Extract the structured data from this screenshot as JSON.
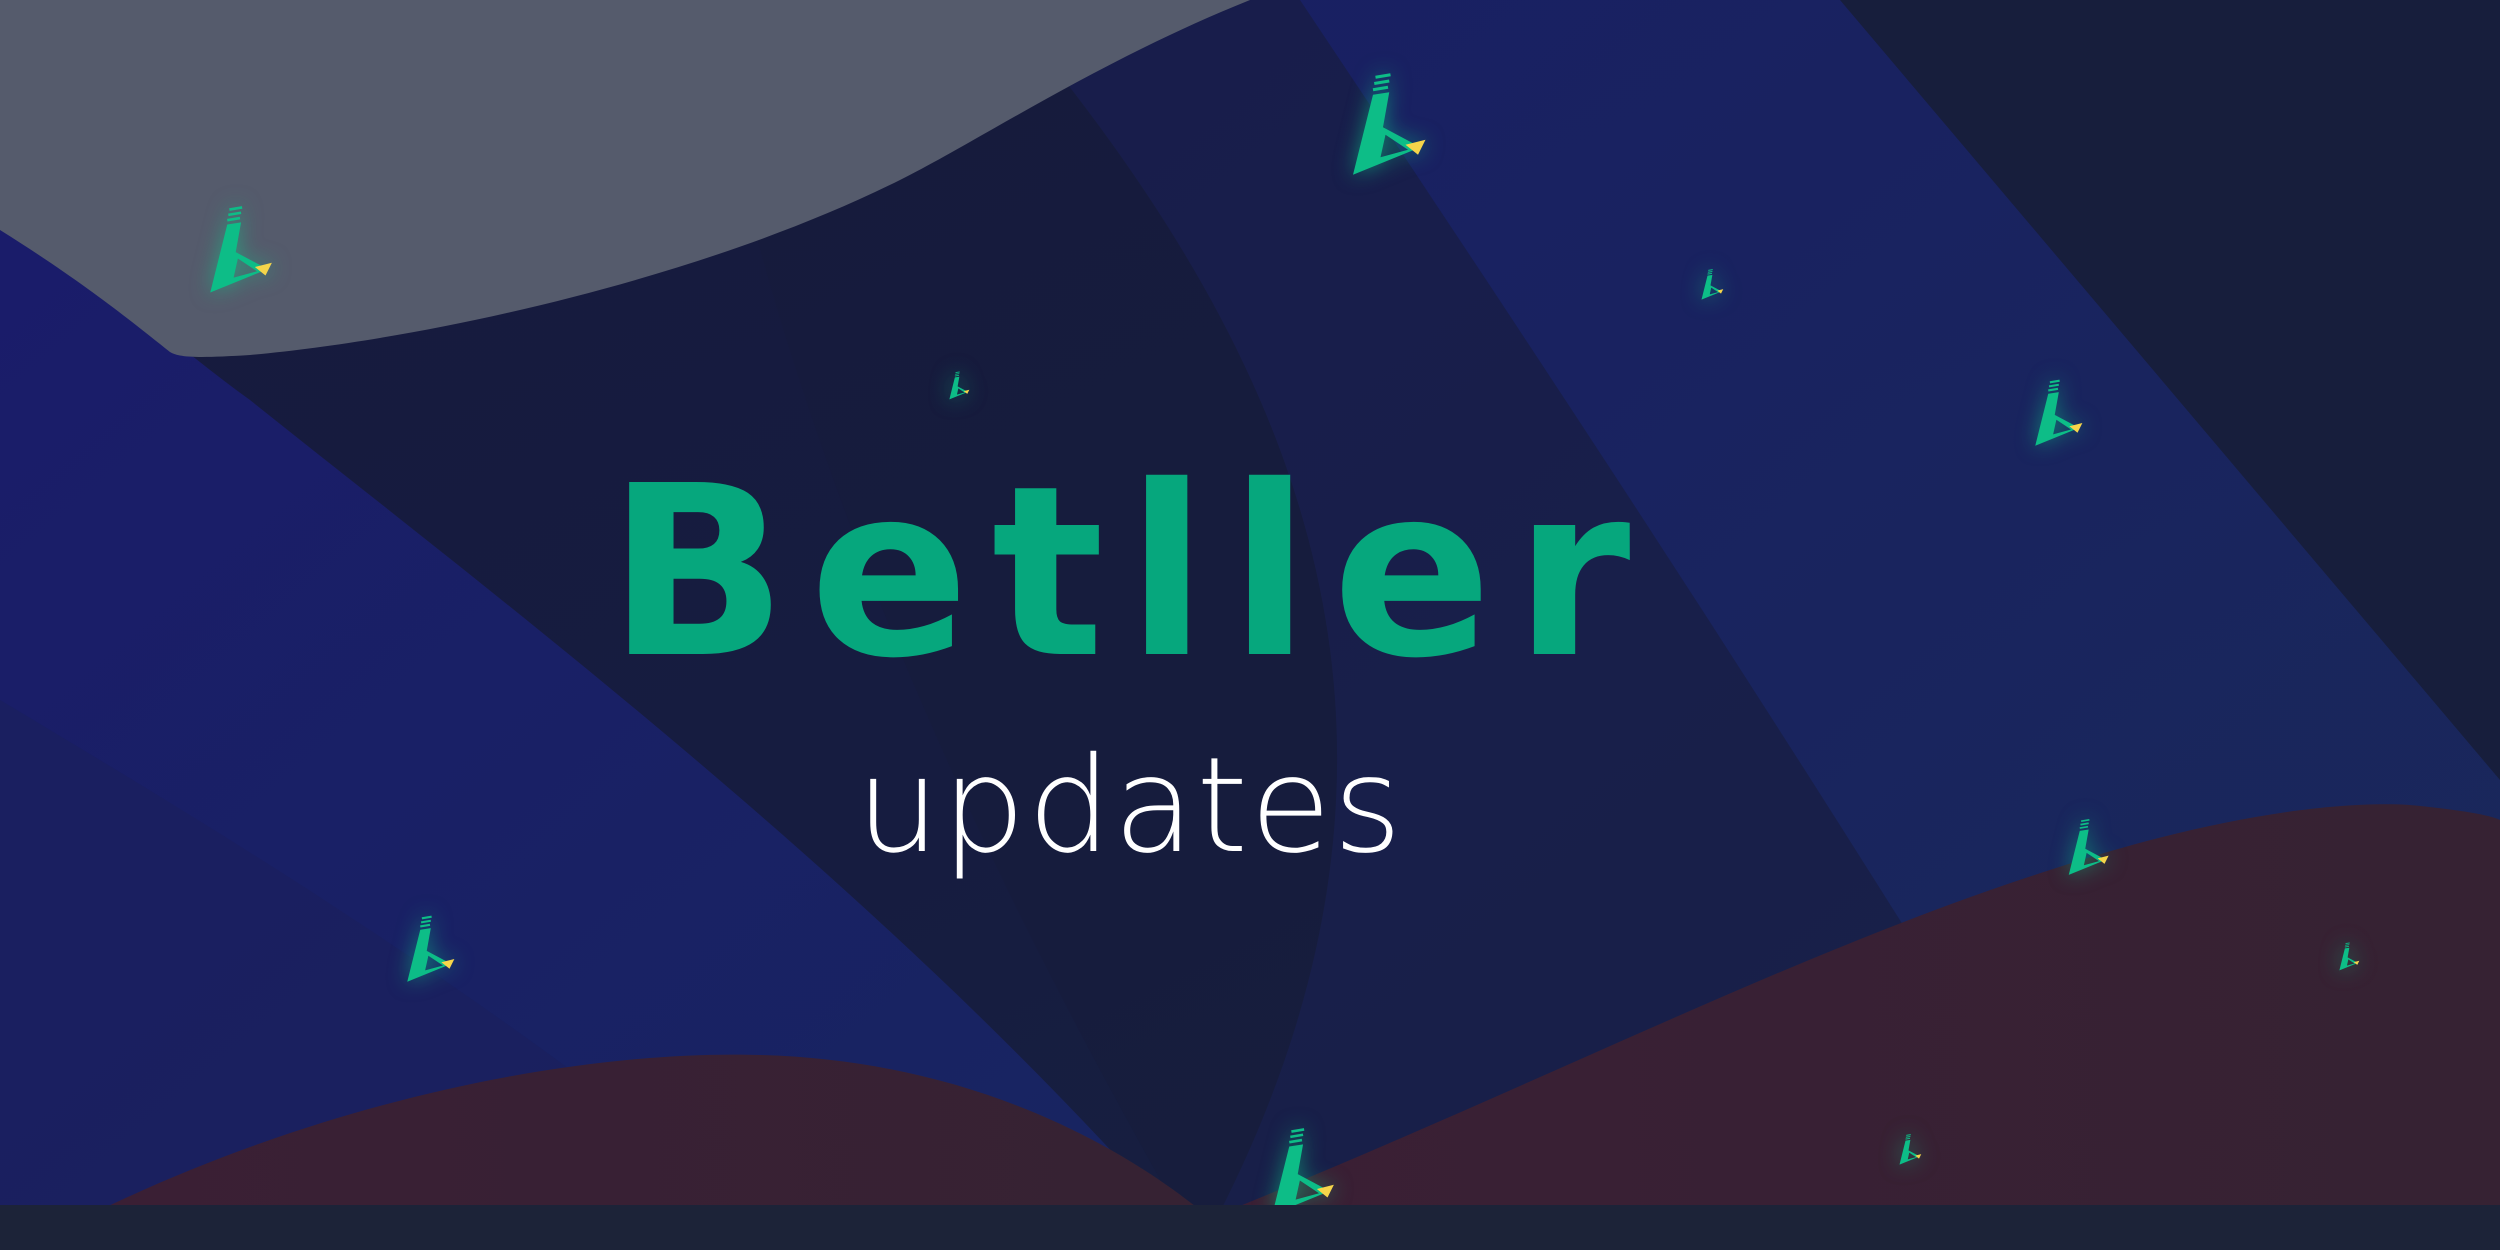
{
  "brand": {
    "title": "Betller",
    "subtitle": "updates"
  },
  "colors": {
    "background": "#181c38",
    "brand_green": "#06a77d",
    "accent_yellow": "#f6d54a",
    "subtitle_white": "#ffffff",
    "gray_wave": "#555b6c",
    "blue_wave": "#1a1f66",
    "red_wave": "#3a1f2e"
  },
  "icons": {
    "logo": "betller-logo-icon"
  }
}
